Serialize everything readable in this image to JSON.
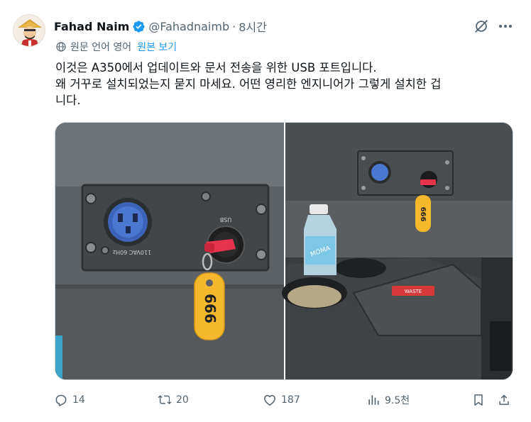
{
  "author": {
    "display_name": "Fahad Naim",
    "handle": "@Fahadnaimb",
    "time": "8시간",
    "verified": true,
    "avatar": "avatar-illustration"
  },
  "translation": {
    "label": "원문 언어 영어",
    "show_original": "원본 보기",
    "icon": "globe-icon"
  },
  "tweet": {
    "lines": [
      "이것은 A350에서 업데이트와 문서 전송을 위한 USB 포트입니다.",
      "왜 거꾸로 설치되었는지 묻지 마세요. 어떤 영리한 엔지니어가 그렇게 설치한 겁",
      "니다."
    ]
  },
  "media": {
    "left_image": {
      "socket_label": "110VAC 60Hz",
      "usb_label": "USB",
      "tag_text": "666"
    },
    "right_image": {
      "tag_text": "666",
      "bottle_label": "MOMA",
      "card_label": "WASTE"
    }
  },
  "actions": {
    "reply": "14",
    "retweet": "20",
    "like": "187",
    "views": "9.5천"
  },
  "colors": {
    "accent": "#1d9bf0",
    "muted": "#536471",
    "text": "#0f1419",
    "tag": "#f5b72c",
    "usb_cap": "#e8334e"
  }
}
